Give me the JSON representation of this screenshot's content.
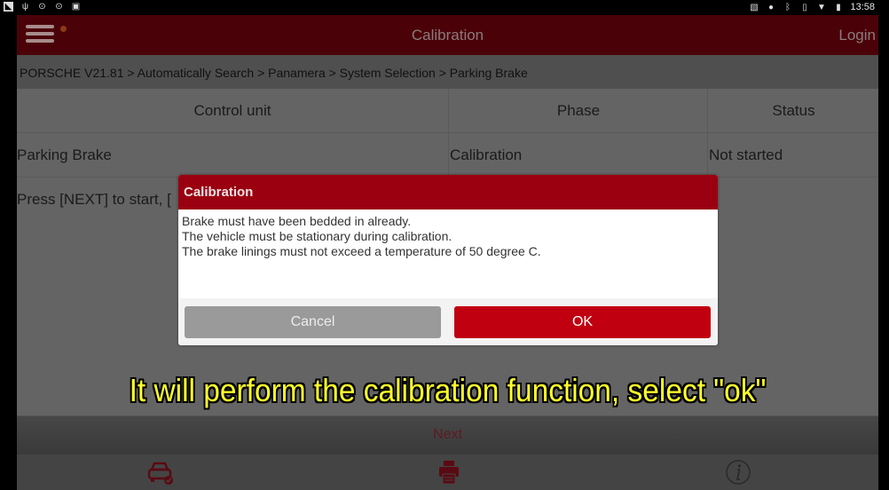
{
  "status_bar": {
    "left_icons": [
      "notification-icon",
      "usb-debug-icon",
      "screenshot-icon",
      "screenshot-icon",
      "image-icon"
    ],
    "right_icons": [
      "cast-icon",
      "location-icon",
      "bluetooth-icon",
      "vibrate-icon",
      "wifi-icon",
      "battery-icon"
    ],
    "time": "13:58"
  },
  "app_bar": {
    "title": "Calibration",
    "login_label": "Login"
  },
  "breadcrumb": "PORSCHE V21.81 > Automatically Search > Panamera > System Selection > Parking Brake",
  "table": {
    "headers": [
      "Control unit",
      "Phase",
      "Status"
    ],
    "rows": [
      [
        "Parking Brake",
        "Calibration",
        "Not started"
      ]
    ],
    "message": "Press [NEXT] to start, ["
  },
  "dialog": {
    "title": "Calibration",
    "lines": [
      "Brake must have been bedded in already.",
      "The vehicle must be stationary during calibration.",
      "The brake linings must not exceed a temperature of 50 degree C."
    ],
    "cancel_label": "Cancel",
    "ok_label": "OK"
  },
  "caption": "It will perform the calibration function, select \"ok\"",
  "next_label": "Next",
  "toolbar": {
    "items": [
      "vehicle-check-icon",
      "print-icon",
      "info-icon"
    ]
  },
  "colors": {
    "brand_red": "#c00010",
    "header_red": "#9a0010",
    "caption_yellow": "#ffff2a"
  }
}
